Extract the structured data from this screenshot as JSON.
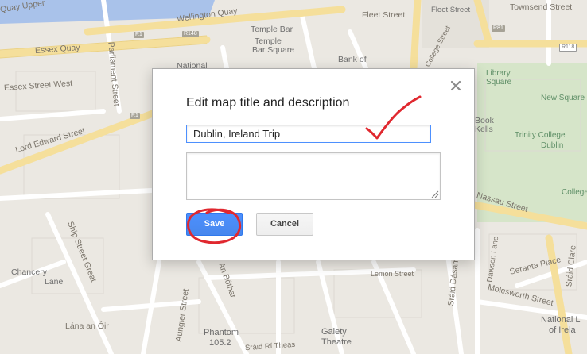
{
  "dialog": {
    "title": "Edit map title and description",
    "title_value": "Dublin, Ireland Trip",
    "description_value": "",
    "save_label": "Save",
    "cancel_label": "Cancel",
    "close_icon": "close-icon",
    "accent_color": "#4d90fe",
    "annotation_color": "#e0282f"
  },
  "map": {
    "labels": {
      "quay_upper": "Quay Upper",
      "wellington_quay": "Wellington Quay",
      "essex_quay": "Essex Quay",
      "essex_street_west": "Essex Street West",
      "parliament_street": "Parliament Street",
      "temple_bar": "Temple Bar",
      "temple_bar_square_1": "Temple",
      "temple_bar_square_2": "Bar Square",
      "national": "National",
      "bank_of": "Bank of",
      "fleet_street": "Fleet Street",
      "fleet_street_2": "Fleet Street",
      "townsend_street": "Townsend Street",
      "college_street": "College Street",
      "library_square_1": "Library",
      "library_square_2": "Square",
      "new_square": "New Square",
      "book_kells_1": "Book",
      "book_kells_2": "Kells",
      "trinity_college_1": "Trinity College",
      "trinity_college_2": "Dublin",
      "college": "College",
      "lord_edward_street": "Lord Edward Street",
      "nassau_street": "Nassau Street",
      "ship_street_great": "Ship Street Great",
      "chancery_lane_1": "Chancery",
      "chancery_lane_2": "Lane",
      "lan_an_oir": "Lána an Óir",
      "aungier_street": "Aungier Street",
      "an_bothar": "An Bóthar",
      "phantom_1": "Phantom",
      "phantom_2": "105.2",
      "gaiety_1": "Gaiety",
      "gaiety_2": "Theatre",
      "sraid_ri": "Sráid Rí Theas",
      "dawson_lane": "Dawson Lane",
      "seranta_place": "Seranta Place",
      "molesworth_street": "Molesworth Street",
      "lemon_street": "Lemon Street",
      "national_lib_1": "National L",
      "national_lib_2": "of Irela",
      "sraid_dasam": "Sráid Dásam",
      "sraid_clare": "Sráid Clare"
    },
    "badges": {
      "r1_a": "R1",
      "r1_b": "R1",
      "r148": "R148",
      "r118": "R118",
      "r81": "R81"
    }
  }
}
